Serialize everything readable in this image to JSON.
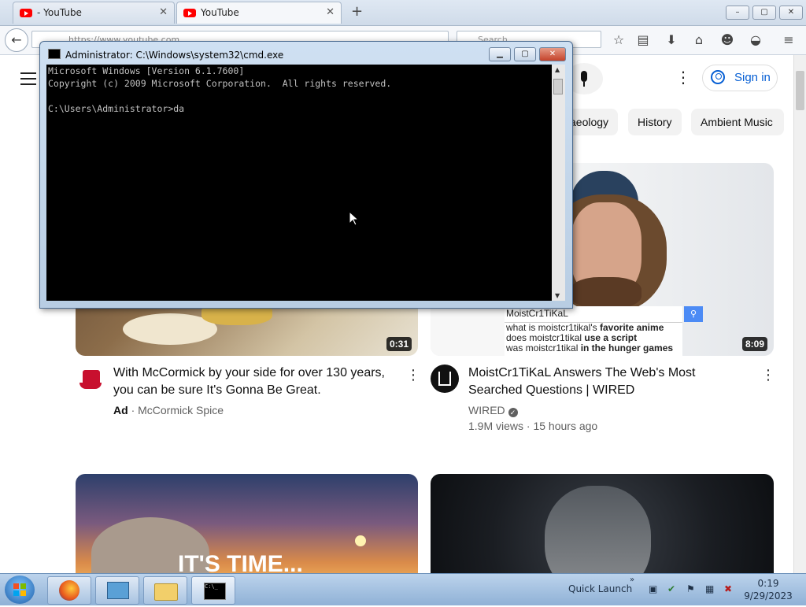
{
  "browser": {
    "tabs": [
      {
        "label": "- YouTube",
        "active": false
      },
      {
        "label": "YouTube",
        "active": true
      }
    ],
    "new_tab": "+",
    "url": "https://www.youtube.com",
    "search_placeholder": "Search",
    "window_controls": [
      "–",
      "▢",
      "✕"
    ]
  },
  "youtube": {
    "sign_in": "Sign in",
    "chips": [
      "aeology",
      "History",
      "Ambient Music"
    ],
    "videos": [
      {
        "title_line1": "With McCormick by your side for over 130 years,",
        "title_line2": "you can be sure It's Gonna Be Great.",
        "ad_label": "Ad",
        "separator": "·",
        "channel": "McCormick Spice",
        "duration": "0:31"
      },
      {
        "title_line1": "MoistCr1TiKaL Answers The Web's Most",
        "title_line2": "Searched Questions | WIRED",
        "channel": "WIRED",
        "stats": "1.9M views · 15 hours ago",
        "duration": "8:09",
        "search_overlay": {
          "query": "MoistCr1TiKaL",
          "suggestions": [
            {
              "pre": "what is moistcr1tikal's ",
              "bold": "favorite anime"
            },
            {
              "pre": "does moistcr1tikal ",
              "bold": "use a script"
            },
            {
              "pre": "was moistcr1tikal ",
              "bold": "in the hunger games"
            }
          ]
        }
      },
      {
        "thumb_text": "IT'S TIME..."
      }
    ]
  },
  "cmd": {
    "title": "Administrator: C:\\Windows\\system32\\cmd.exe",
    "lines": [
      "Microsoft Windows [Version 6.1.7600]",
      "Copyright (c) 2009 Microsoft Corporation.  All rights reserved.",
      "",
      "C:\\Users\\Administrator>da"
    ]
  },
  "taskbar": {
    "quick_launch": "Quick Launch",
    "time": "0:19",
    "date": "9/29/2023"
  }
}
